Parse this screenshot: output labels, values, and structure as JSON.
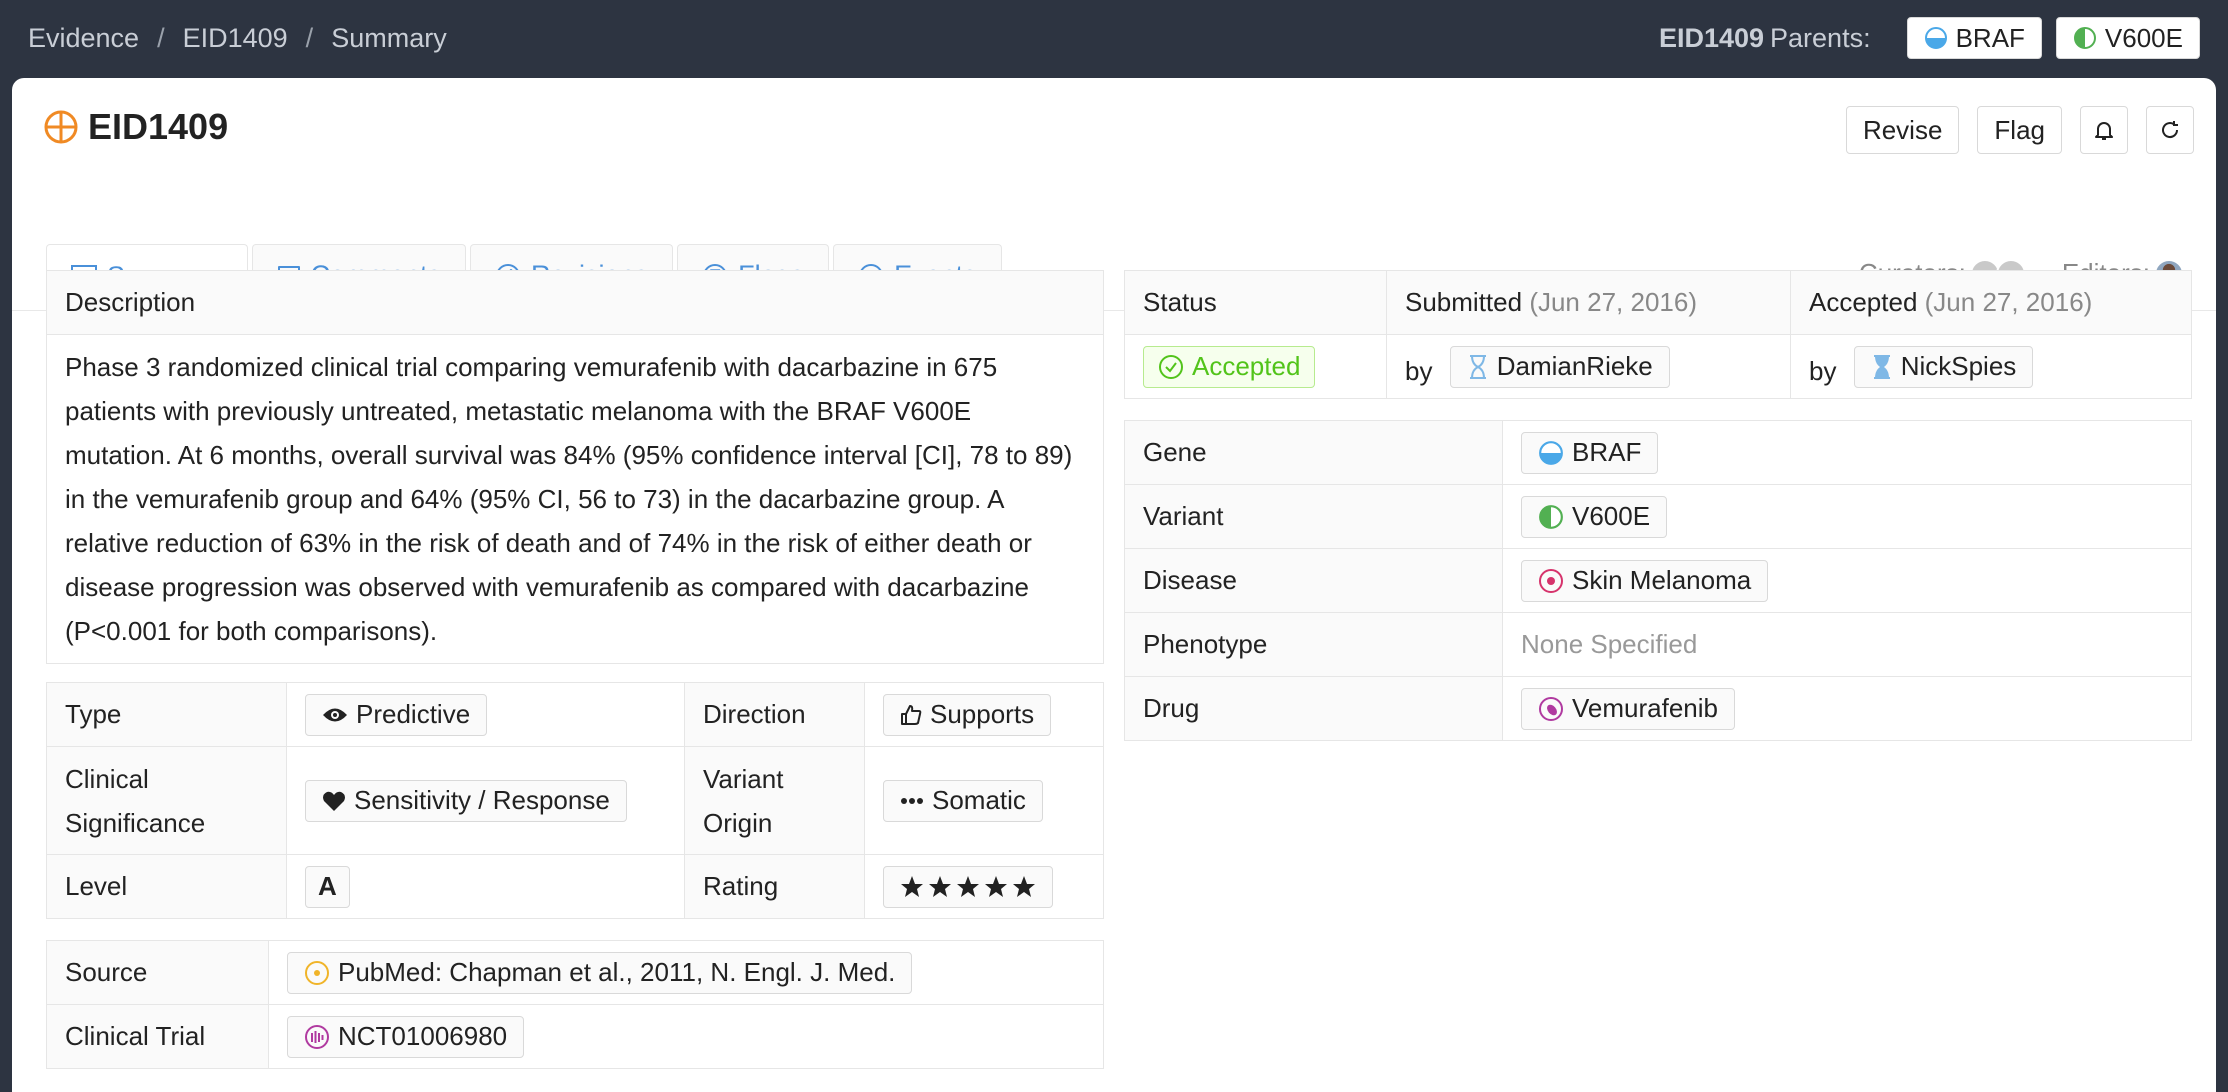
{
  "breadcrumb": [
    "Evidence",
    "EID1409",
    "Summary"
  ],
  "parents": {
    "eid": "EID1409",
    "label": "Parents:",
    "items": [
      "BRAF",
      "V600E"
    ]
  },
  "title": "EID1409",
  "actions": {
    "revise": "Revise",
    "flag": "Flag"
  },
  "tabs": [
    "Summary",
    "Comments",
    "Revisions",
    "Flags",
    "Events"
  ],
  "people": {
    "curators": "Curators:",
    "editors": "Editors:"
  },
  "description": {
    "label": "Description",
    "text": "Phase 3 randomized clinical trial comparing vemurafenib with dacarbazine in 675 patients with previously untreated, metastatic melanoma with the BRAF V600E mutation. At 6 months, overall survival was 84% (95% confidence interval [CI], 78 to 89) in the vemurafenib group and 64% (95% CI, 56 to 73) in the dacarbazine group. A relative reduction of 63% in the risk of death and of 74% in the risk of either death or disease progression was observed with vemurafenib as compared with dacarbazine (P<0.001 for both comparisons)."
  },
  "attrs": {
    "type_label": "Type",
    "type_value": "Predictive",
    "direction_label": "Direction",
    "direction_value": "Supports",
    "significance_label": "Clinical Significance",
    "significance_value": "Sensitivity / Response",
    "origin_label": "Variant Origin",
    "origin_value": "Somatic",
    "level_label": "Level",
    "level_value": "A",
    "rating_label": "Rating",
    "rating_value": 5
  },
  "source": {
    "source_label": "Source",
    "source_value": "PubMed: Chapman et al., 2011, N. Engl. J. Med.",
    "trial_label": "Clinical Trial",
    "trial_value": "NCT01006980"
  },
  "status": {
    "status_label": "Status",
    "status_value": "Accepted",
    "submitted_label": "Submitted",
    "submitted_date": "(Jun 27, 2016)",
    "submitted_by": "by",
    "submitted_user": "DamianRieke",
    "accepted_label": "Accepted",
    "accepted_date": "(Jun 27, 2016)",
    "accepted_by": "by",
    "accepted_user": "NickSpies"
  },
  "entities": {
    "gene_label": "Gene",
    "gene_value": "BRAF",
    "variant_label": "Variant",
    "variant_value": "V600E",
    "disease_label": "Disease",
    "disease_value": "Skin Melanoma",
    "phenotype_label": "Phenotype",
    "phenotype_value": "None Specified",
    "drug_label": "Drug",
    "drug_value": "Vemurafenib"
  },
  "colors": {
    "link": "#4a90d9",
    "accepted": "#52c41a",
    "gene": "#4aa8e8",
    "variant": "#52b052",
    "disease": "#d6336c",
    "drug": "#b03aa0"
  }
}
